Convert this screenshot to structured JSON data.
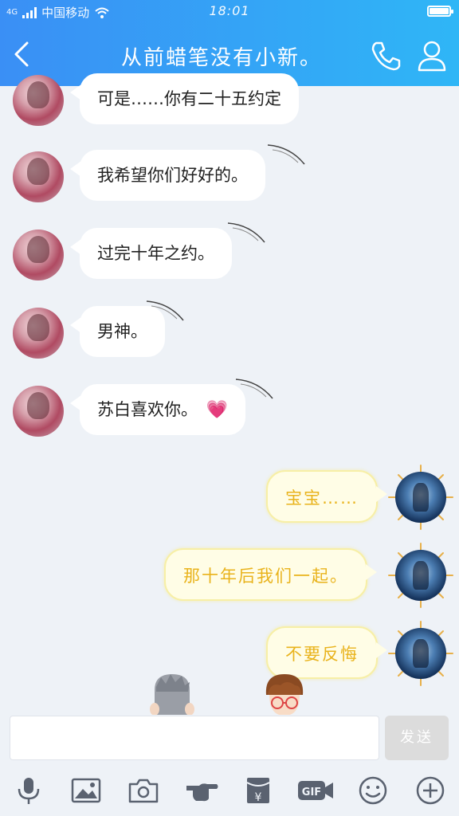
{
  "status_bar": {
    "network": "4G",
    "carrier": "中国移动",
    "time": "18:01"
  },
  "header": {
    "title": "从前蜡笔没有小新。"
  },
  "messages_left": [
    {
      "text": "可是……你有二十五约定"
    },
    {
      "text": "我希望你们好好的。"
    },
    {
      "text": "过完十年之约。"
    },
    {
      "text": "男神。"
    },
    {
      "text": "苏白喜欢你。"
    }
  ],
  "messages_right": [
    {
      "text": "宝宝……"
    },
    {
      "text": "那十年后我们一起。"
    },
    {
      "text": "不要反悔"
    }
  ],
  "emoji": "💗",
  "input": {
    "value": "",
    "send_label": "发送"
  },
  "toolbar_icons": [
    "microphone-icon",
    "image-icon",
    "camera-icon",
    "poke-icon",
    "red-packet-icon",
    "gif-icon",
    "emoji-icon",
    "plus-icon"
  ],
  "colors": {
    "header_start": "#3a8ff5",
    "header_end": "#2fb6f6",
    "chat_background": "#eef2f7",
    "right_bubble_text": "#e9b31c",
    "right_bubble_bg": "#fffde6"
  }
}
